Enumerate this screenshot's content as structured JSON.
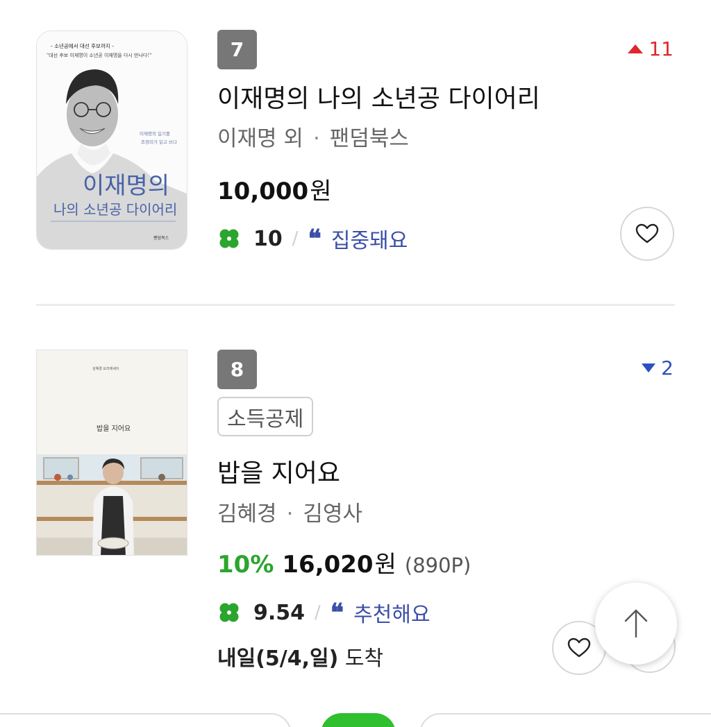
{
  "items": [
    {
      "rank": "7",
      "change": "11",
      "change_dir": "up",
      "cover": {
        "tagline": "- 소년공에서 대선 후보까지 -",
        "quote": "\"대선 후보 이재명이 소년공 이재명을 다시 만나다!\"",
        "side_text_1": "이재명의 일기를",
        "side_text_2": "조정미가 읽고 쓰다",
        "big_title_1": "이재명의",
        "big_title_2": "나의 소년공 다이어리",
        "publisher_mark": "팬덤북스"
      },
      "title": "이재명의 나의 소년공 다이어리",
      "author": "이재명 외",
      "publisher": "팬덤북스",
      "price": "10,000",
      "currency": "원",
      "score": "10",
      "review": "집중돼요"
    },
    {
      "rank": "8",
      "change": "2",
      "change_dir": "down",
      "tag": "소득공제",
      "cover": {
        "series": "김혜경 요리에세이",
        "title": "밥을 지어요"
      },
      "title": "밥을 지어요",
      "author": "김혜경",
      "publisher": "김영사",
      "discount": "10%",
      "price": "16,020",
      "currency": "원",
      "points": "(890P)",
      "score": "9.54",
      "review": "추천해요",
      "delivery_bold": "내일(5/4,일)",
      "delivery_rest": " 도착"
    }
  ],
  "icons": {
    "clover": "clover-icon",
    "quote": "quote-icon",
    "heart": "heart-icon",
    "arrow_up": "arrow-up-icon"
  },
  "colors": {
    "rank_bg": "#777777",
    "rank_up": "#e0262d",
    "rank_down": "#2d4fc0",
    "clover": "#2ba52e",
    "review": "#3c4fa8",
    "discount": "#2ba52e"
  }
}
